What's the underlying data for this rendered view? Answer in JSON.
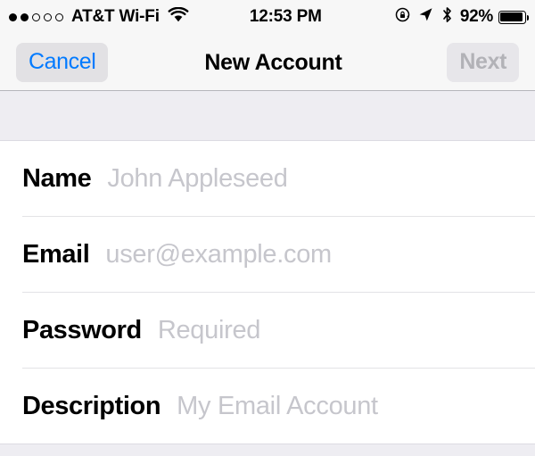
{
  "status_bar": {
    "signal_dots_filled": 2,
    "signal_dots_total": 5,
    "carrier": "AT&T Wi-Fi",
    "wifi_icon": "wifi-icon",
    "time": "12:53 PM",
    "rotation_lock_icon": "rotation-lock-icon",
    "location_icon": "location-arrow-icon",
    "bluetooth_icon": "bluetooth-icon",
    "battery_percent": "92%",
    "battery_level": 92
  },
  "nav_bar": {
    "cancel_label": "Cancel",
    "title": "New Account",
    "next_label": "Next",
    "next_enabled": false,
    "accent_color": "#007aff",
    "disabled_color": "#b2b2b7"
  },
  "form": {
    "fields": [
      {
        "label": "Name",
        "value": "",
        "placeholder": "John Appleseed"
      },
      {
        "label": "Email",
        "value": "",
        "placeholder": "user@example.com"
      },
      {
        "label": "Password",
        "value": "",
        "placeholder": "Required"
      },
      {
        "label": "Description",
        "value": "",
        "placeholder": "My Email Account"
      }
    ]
  }
}
